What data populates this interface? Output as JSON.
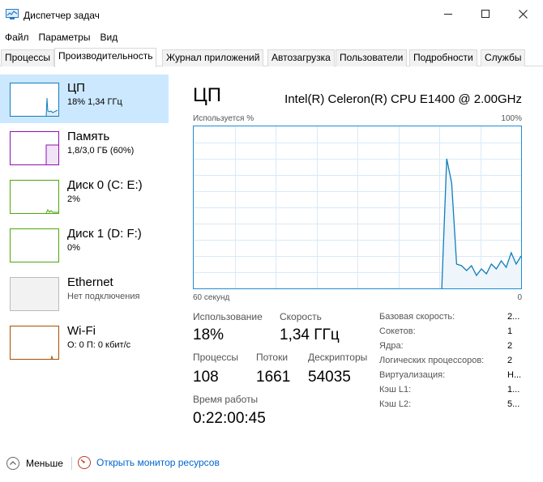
{
  "window": {
    "title": "Диспетчер задач"
  },
  "menu": [
    "Файл",
    "Параметры",
    "Вид"
  ],
  "tabs": [
    "Процессы",
    "Производительность",
    "Журнал приложений",
    "Автозагрузка",
    "Пользователи",
    "Подробности",
    "Службы"
  ],
  "active_tab": "Производительность",
  "sidebar": [
    {
      "name": "ЦП",
      "sub": "18% 1,34 ГГц",
      "color": "#117dbb",
      "active": true
    },
    {
      "name": "Память",
      "sub": "1,8/3,0 ГБ (60%)",
      "color": "#8b12ae",
      "active": false
    },
    {
      "name": "Диск 0 (C: E:)",
      "sub": "2%",
      "color": "#4da60c",
      "active": false
    },
    {
      "name": "Диск 1 (D: F:)",
      "sub": "0%",
      "color": "#4da60c",
      "active": false
    },
    {
      "name": "Ethernet",
      "sub": "Нет подключения",
      "color": "#bbbbbb",
      "active": false
    },
    {
      "name": "Wi-Fi",
      "sub": "О: 0 П: 0 кбит/с",
      "color": "#a74f01",
      "active": false
    }
  ],
  "main": {
    "title": "ЦП",
    "cpu_model": "Intel(R) Celeron(R) CPU E1400 @ 2.00GHz",
    "usage_label": "Используется %",
    "max_label": "100%",
    "time_label": "60 секунд",
    "zero_label": "0",
    "accent": "#117dbb",
    "graph_series": [
      0,
      0,
      0,
      0,
      0,
      0,
      0,
      0,
      0,
      0,
      0,
      0,
      0,
      0,
      0,
      0,
      0,
      0,
      0,
      0,
      0,
      0,
      0,
      0,
      0,
      0,
      0,
      0,
      0,
      0,
      0,
      0,
      0,
      0,
      0,
      0,
      0,
      0,
      0,
      0,
      0,
      0,
      0,
      0,
      0,
      0,
      0,
      0,
      0,
      0,
      0,
      80,
      65,
      15,
      14,
      11,
      14,
      8,
      12,
      9,
      15,
      12,
      17,
      13,
      22,
      15,
      20
    ]
  },
  "stats": {
    "usage_label": "Использование",
    "usage_value": "18%",
    "speed_label": "Скорость",
    "speed_value": "1,34 ГГц",
    "proc_label": "Процессы",
    "proc_value": "108",
    "threads_label": "Потоки",
    "threads_value": "1661",
    "handles_label": "Дескрипторы",
    "handles_value": "54035",
    "uptime_label": "Время работы",
    "uptime_value": "0:22:00:45"
  },
  "details": [
    {
      "key": "Базовая скорость:",
      "value": "2..."
    },
    {
      "key": "Сокетов:",
      "value": "1"
    },
    {
      "key": "Ядра:",
      "value": "2"
    },
    {
      "key": "Логических процессоров:",
      "value": "2"
    },
    {
      "key": "Виртуализация:",
      "value": "Н..."
    },
    {
      "key": "Кэш L1:",
      "value": "1..."
    },
    {
      "key": "Кэш L2:",
      "value": "5..."
    }
  ],
  "bottom": {
    "less_label": "Меньше",
    "resmon_label": "Открыть монитор ресурсов"
  }
}
